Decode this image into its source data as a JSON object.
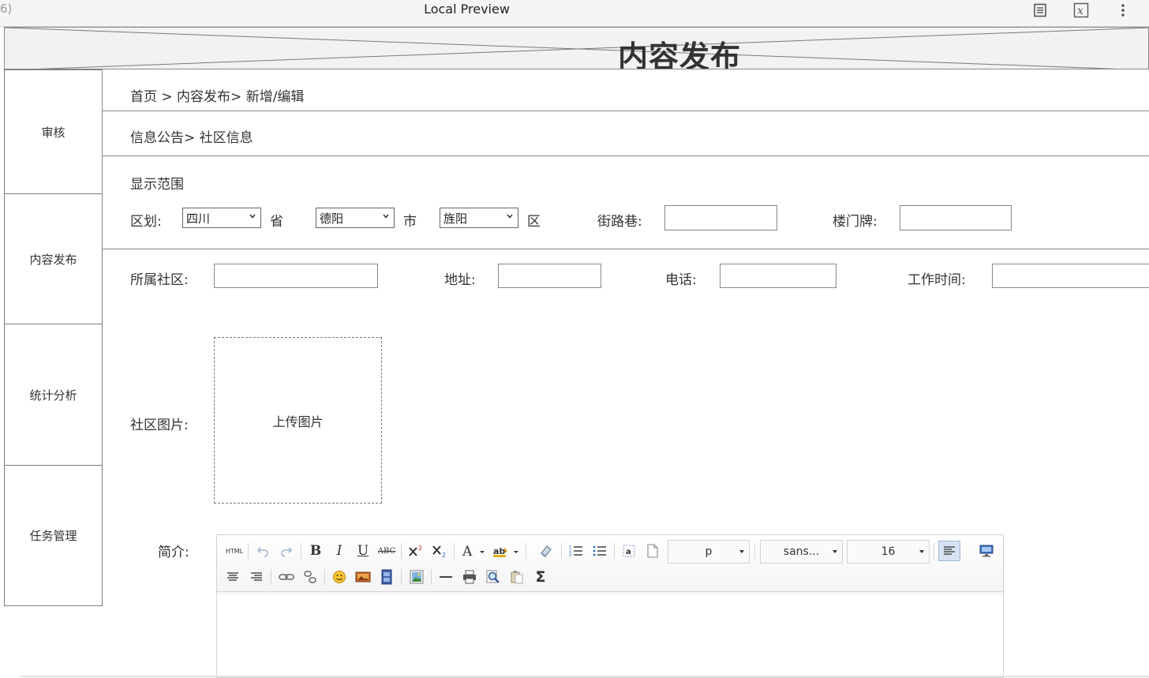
{
  "window": {
    "left_fragment": "6)",
    "title": "Local Preview"
  },
  "header": {
    "title": "内容发布"
  },
  "sidebar": {
    "items": [
      {
        "label": "审核"
      },
      {
        "label": "内容发布"
      },
      {
        "label": "统计分析"
      },
      {
        "label": "任务管理"
      }
    ]
  },
  "breadcrumb": {
    "text": "首页 > 内容发布> 新增/编辑"
  },
  "category": {
    "text": "信息公告> 社区信息"
  },
  "scope": {
    "label": "显示范围",
    "district_label": "区划:",
    "province": {
      "value": "四川",
      "suffix": "省"
    },
    "city": {
      "value": "德阳",
      "suffix": "市"
    },
    "area": {
      "value": "旌阳",
      "suffix": "区"
    },
    "street_label": "街路巷:",
    "street_value": "",
    "door_label": "楼门牌:",
    "door_value": ""
  },
  "details": {
    "community_label": "所属社区:",
    "community_value": "",
    "address_label": "地址:",
    "address_value": "",
    "phone_label": "电话:",
    "phone_value": "",
    "hours_label": "工作时间:",
    "hours_value": ""
  },
  "image": {
    "label": "社区图片:",
    "upload_text": "上传图片"
  },
  "intro": {
    "label": "简介:",
    "toolbar": {
      "html_label": "HTML",
      "paragraph": "p",
      "font": "sans...",
      "size": "16"
    }
  }
}
